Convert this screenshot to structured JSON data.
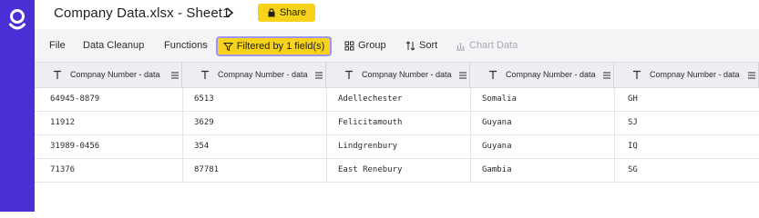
{
  "app": {
    "document_title": "Company Data.xlsx - Sheet1",
    "share_label": "Share"
  },
  "toolbar": {
    "file": "File",
    "data_cleanup": "Data Cleanup",
    "functions": "Functions",
    "filter_label": "Filtered by 1 field(s)",
    "group": "Group",
    "sort": "Sort",
    "chart_data": "Chart Data"
  },
  "grid": {
    "columns": [
      {
        "label": "Compnay Number - data",
        "type_icon": "text-type-icon"
      },
      {
        "label": "Compnay Number - data",
        "type_icon": "text-type-icon"
      },
      {
        "label": "Compnay Number - data",
        "type_icon": "text-type-icon"
      },
      {
        "label": "Compnay Number - data",
        "type_icon": "text-type-icon"
      },
      {
        "label": "Compnay Number - data",
        "type_icon": "text-type-icon"
      }
    ],
    "rows": [
      [
        "64945-8879",
        "6513",
        "Adellechester",
        "Somalia",
        "GH"
      ],
      [
        "11912",
        "3629",
        "Felicitamouth",
        "Guyana",
        "SJ"
      ],
      [
        "31989-0456",
        "354",
        "Lindgrenbury",
        "Guyana",
        "IQ"
      ],
      [
        "71376",
        "87781",
        "East Renebury",
        "Gambia",
        "SG"
      ]
    ]
  },
  "colors": {
    "rail": "#4a2fd6",
    "accent_yellow": "#f7d21a",
    "chip_border": "#9f95f0"
  }
}
